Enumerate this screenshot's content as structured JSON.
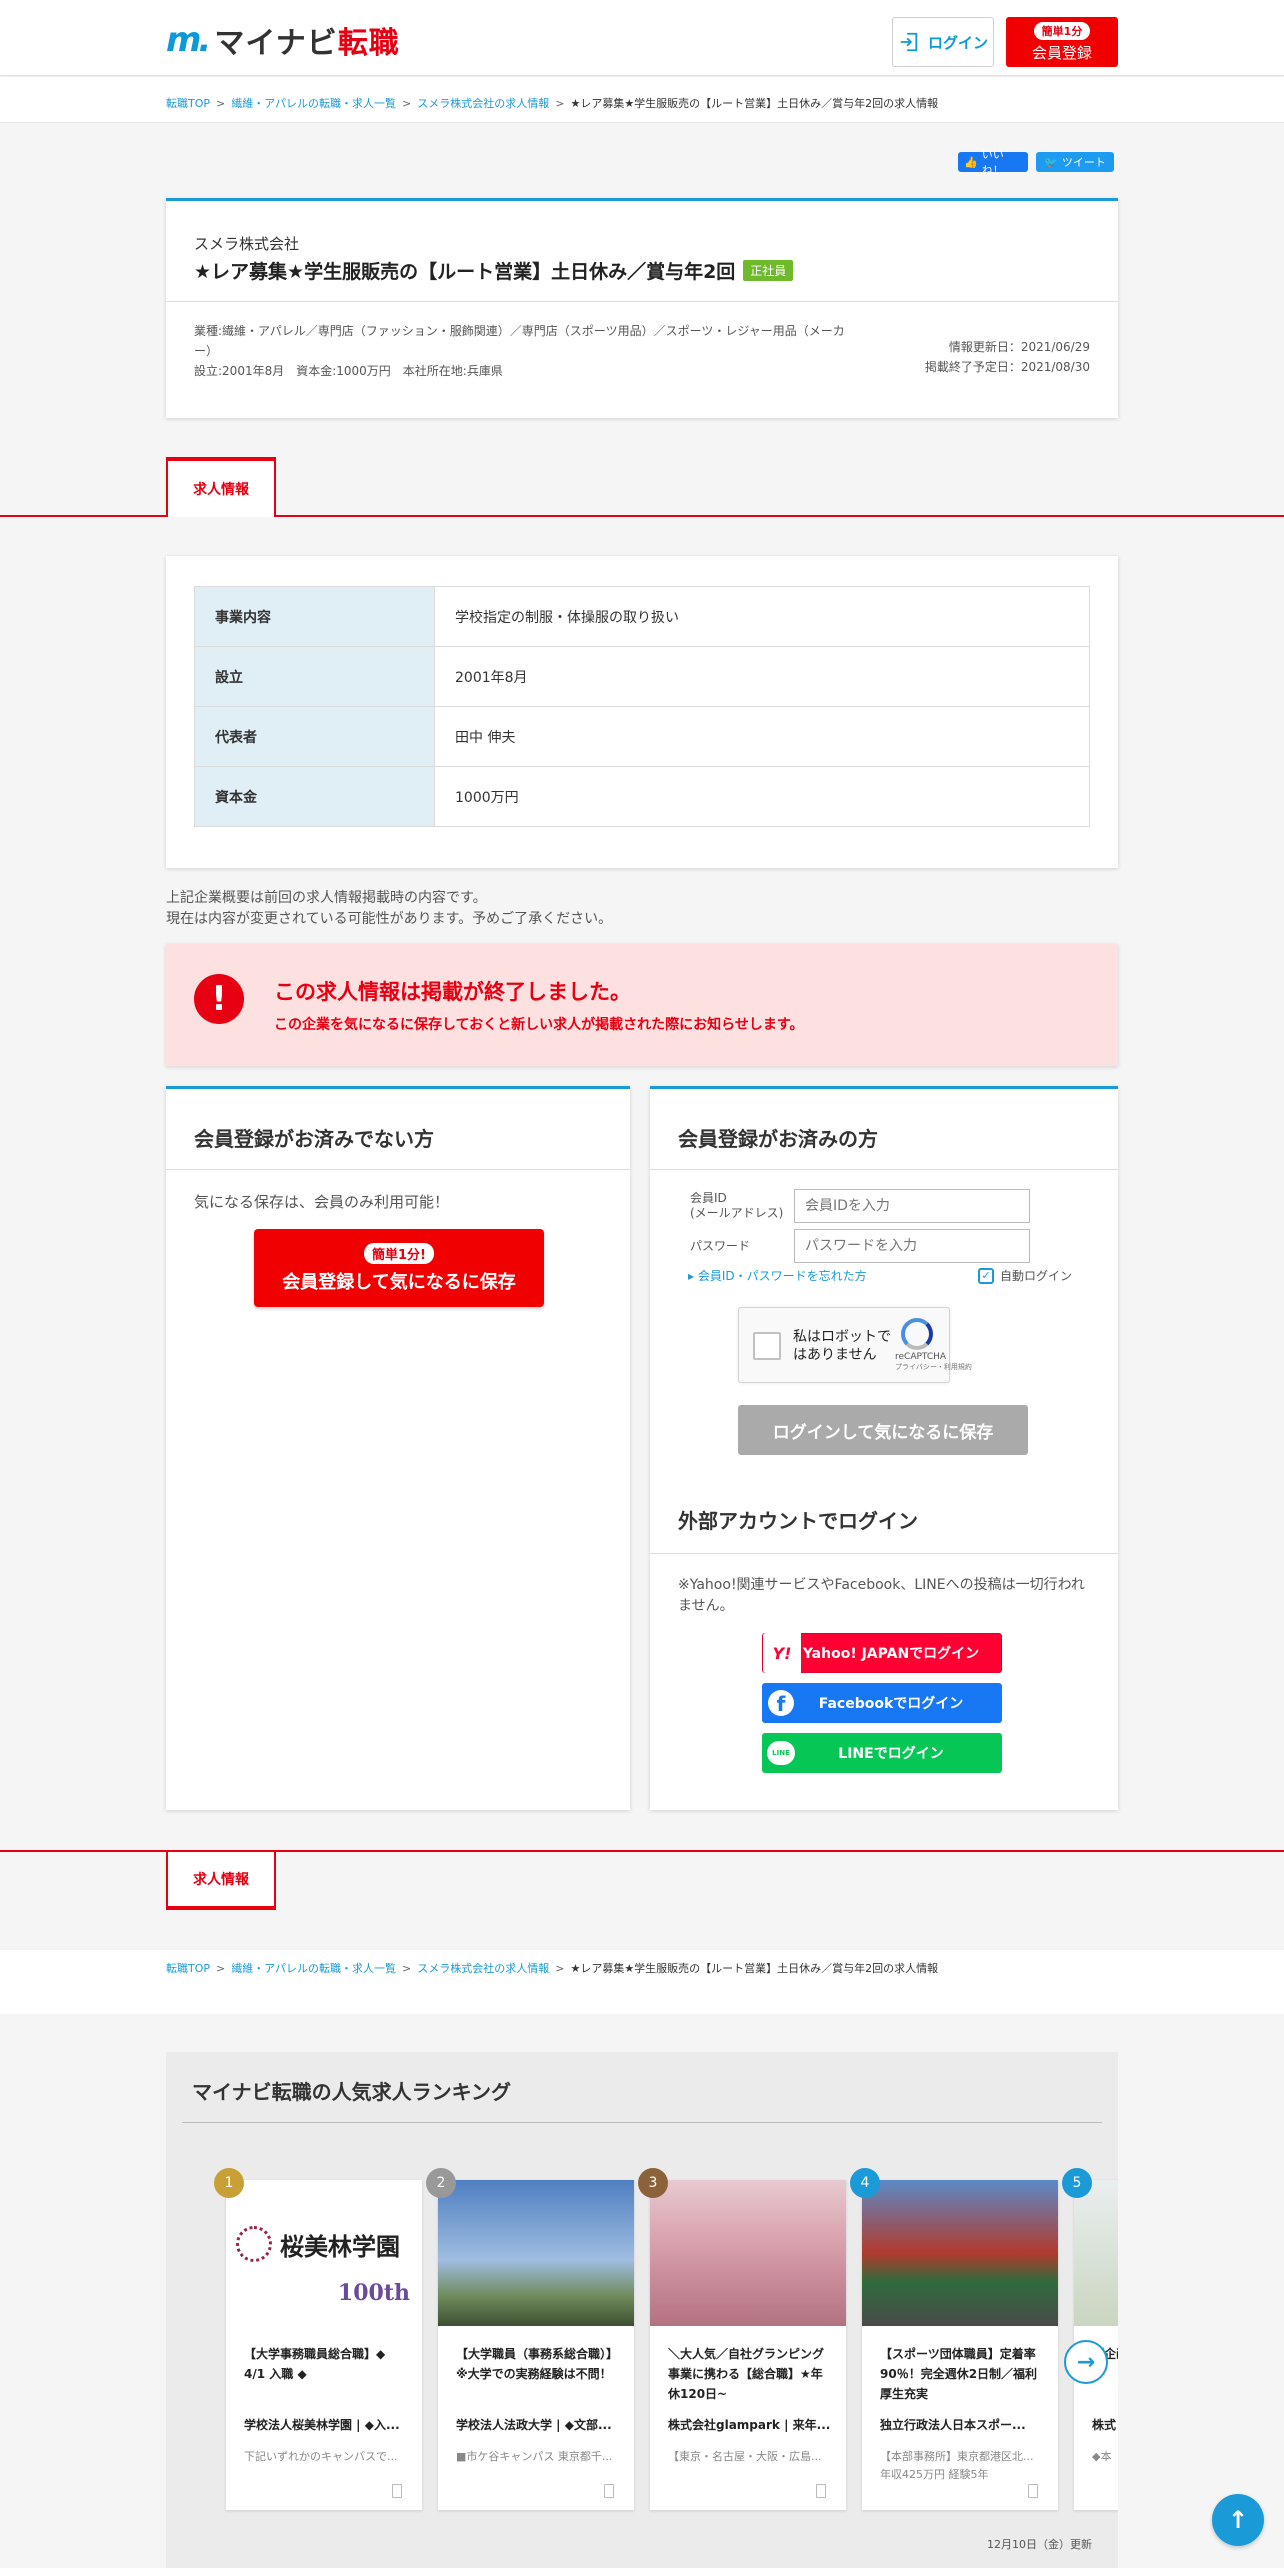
{
  "header": {
    "logo_mark": "m.",
    "logo_main": "マイナビ",
    "logo_accent": "転職",
    "login_label": "ログイン",
    "register_pill": "簡単1分",
    "register_label": "会員登録"
  },
  "breadcrumb": {
    "items": [
      "転職TOP",
      "繊維・アパレルの転職・求人一覧",
      "スメラ株式会社の求人情報",
      "★レア募集★学生服販売の【ルート営業】土日休み／賞与年2回の求人情報"
    ],
    "separator": ">"
  },
  "social": {
    "like_label": "いいね！",
    "tweet_label": "ツイート"
  },
  "job": {
    "company": "スメラ株式会社",
    "title": "★レア募集★学生服販売の【ルート営業】土日休み／賞与年2回",
    "employment_tag": "正社員",
    "industry": "業種:繊維・アパレル／専門店（ファッション・服飾関連）／専門店（スポーツ用品）／スポーツ・レジャー用品（メーカー）",
    "founding_line": "設立:2001年8月　資本金:1000万円　本社所在地:兵庫県",
    "updated": "情報更新日：2021/06/29",
    "end_date": "掲載終了予定日：2021/08/30"
  },
  "tab": {
    "label": "求人情報"
  },
  "company_info": [
    {
      "key": "事業内容",
      "value": "学校指定の制服・体操服の取り扱い"
    },
    {
      "key": "設立",
      "value": "2001年8月"
    },
    {
      "key": "代表者",
      "value": "田中 伸夫"
    },
    {
      "key": "資本金",
      "value": "1000万円"
    }
  ],
  "note": {
    "line1": "上記企業概要は前回の求人情報掲載時の内容です。",
    "line2": "現在は内容が変更されている可能性があります。予めご了承ください。"
  },
  "alert": {
    "icon": "!",
    "title": "この求人情報は掲載が終了しました。",
    "subtitle": "この企業を気になるに保存しておくと新しい求人が掲載された際にお知らせします。"
  },
  "panel_left": {
    "title": "会員登録がお済みでない方",
    "text": "気になる保存は、会員のみ利用可能！",
    "button_pill": "簡単1分!",
    "button_label": "会員登録して気になるに保存"
  },
  "panel_right": {
    "title": "会員登録がお済みの方",
    "id_label_1": "会員ID",
    "id_label_2": "(メールアドレス)",
    "id_placeholder": "会員IDを入力",
    "pw_label": "パスワード",
    "pw_placeholder": "パスワードを入力",
    "forgot": "▸ 会員ID・パスワードを忘れた方",
    "auto_login": "自動ログイン",
    "captcha_text": "私はロボットではありません",
    "captcha_brand": "reCAPTCHA",
    "captcha_links": "プライバシー・利用規約",
    "login_save": "ログインして気になるに保存",
    "ext_title": "外部アカウントでログイン",
    "ext_text": "※Yahoo!関連サービスやFacebook、LINEへの投稿は一切行われません。",
    "yahoo": "Yahoo! JAPANでログイン",
    "facebook": "Facebookでログイン",
    "line": "LINEでログイン",
    "yahoo_icon_text": "Y!",
    "line_icon_text": "LINE"
  },
  "ranking": {
    "title": "マイナビ転職の人気求人ランキング",
    "date": "12月10日（金）更新",
    "items": [
      {
        "rank": "1",
        "rank_color": "#c9a035",
        "title": "【大学事務職員総合職】◆ 4/1 入職 ◆",
        "company": "学校法人桜美林学園 | ◆入...",
        "location": "下記いずれかのキャンパスで...",
        "extra": "",
        "image_text": "桜美林学園",
        "image_sub": "100th"
      },
      {
        "rank": "2",
        "rank_color": "#999999",
        "title": "【大学職員（事務系総合職）】※大学での実務経験は不問！",
        "company": "学校法人法政大学 | ◆文部...",
        "location": "■市ケ谷キャンパス 東京都千...",
        "extra": "",
        "image_text": "",
        "image_sub": ""
      },
      {
        "rank": "3",
        "rank_color": "#8c6239",
        "title": "＼大人気／自社グランピング事業に携わる【総合職】★年休120日~",
        "company": "株式会社glampark | 来年...",
        "location": "【東京・名古屋・大阪・広島...",
        "extra": "",
        "image_text": "",
        "image_sub": ""
      },
      {
        "rank": "4",
        "rank_color": "#1a9ad6",
        "title": "【スポーツ団体職員】定着率90％！完全週休2日制／福利厚生充実",
        "company": "独立行政法人日本スポー...",
        "location": "【本部事務所】東京都港区北...",
        "extra": "年収425万円 経験5年",
        "image_text": "",
        "image_sub": ""
      },
      {
        "rank": "5",
        "rank_color": "#1a9ad6",
        "title": "【企画】国際エ...年休",
        "company": "株式",
        "location": "◆本",
        "extra": "",
        "image_text": "",
        "image_sub": ""
      }
    ]
  }
}
